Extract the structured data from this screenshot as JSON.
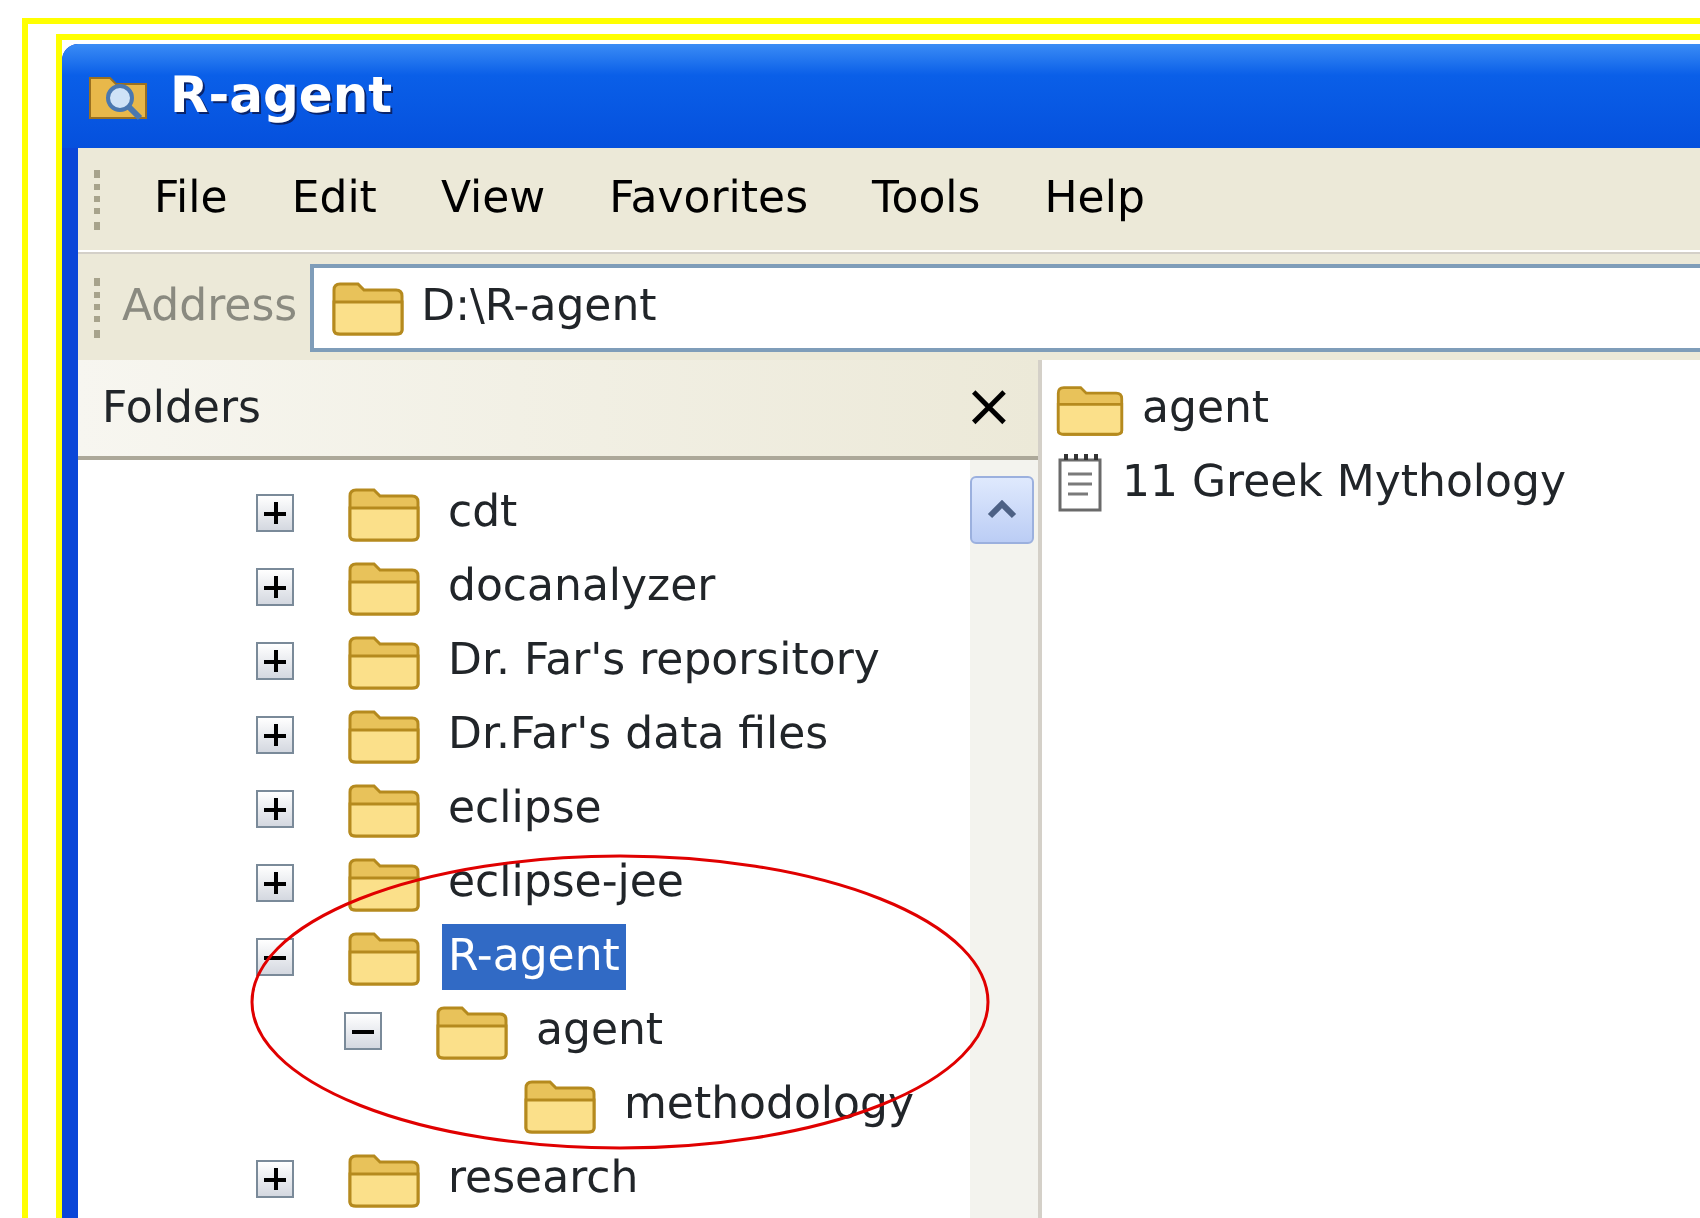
{
  "window": {
    "title": "R-agent"
  },
  "menu": [
    "File",
    "Edit",
    "View",
    "Favorites",
    "Tools",
    "Help"
  ],
  "address": {
    "label": "Address",
    "value": "D:\\R-agent"
  },
  "folders_pane": {
    "title": "Folders",
    "close": "×",
    "tree": [
      {
        "label": "cdt",
        "expandable": true,
        "expanded": false,
        "selected": false
      },
      {
        "label": "docanalyzer",
        "expandable": true,
        "expanded": false,
        "selected": false
      },
      {
        "label": "Dr. Far's reporsitory",
        "expandable": true,
        "expanded": false,
        "selected": false
      },
      {
        "label": "Dr.Far's data files",
        "expandable": true,
        "expanded": false,
        "selected": false
      },
      {
        "label": "eclipse",
        "expandable": true,
        "expanded": false,
        "selected": false
      },
      {
        "label": "eclipse-jee",
        "expandable": true,
        "expanded": false,
        "selected": false
      },
      {
        "label": "R-agent",
        "expandable": true,
        "expanded": true,
        "selected": true,
        "children": [
          {
            "label": "agent",
            "expandable": true,
            "expanded": true,
            "selected": false,
            "children": [
              {
                "label": "methodology",
                "expandable": false,
                "selected": false
              }
            ]
          }
        ]
      },
      {
        "label": "research",
        "expandable": true,
        "expanded": false,
        "selected": false
      }
    ]
  },
  "files": [
    {
      "kind": "folder",
      "label": "agent"
    },
    {
      "kind": "document",
      "label": "11 Greek Mythology"
    }
  ],
  "annotation": {
    "kind": "ellipse",
    "color": "#e00000"
  }
}
